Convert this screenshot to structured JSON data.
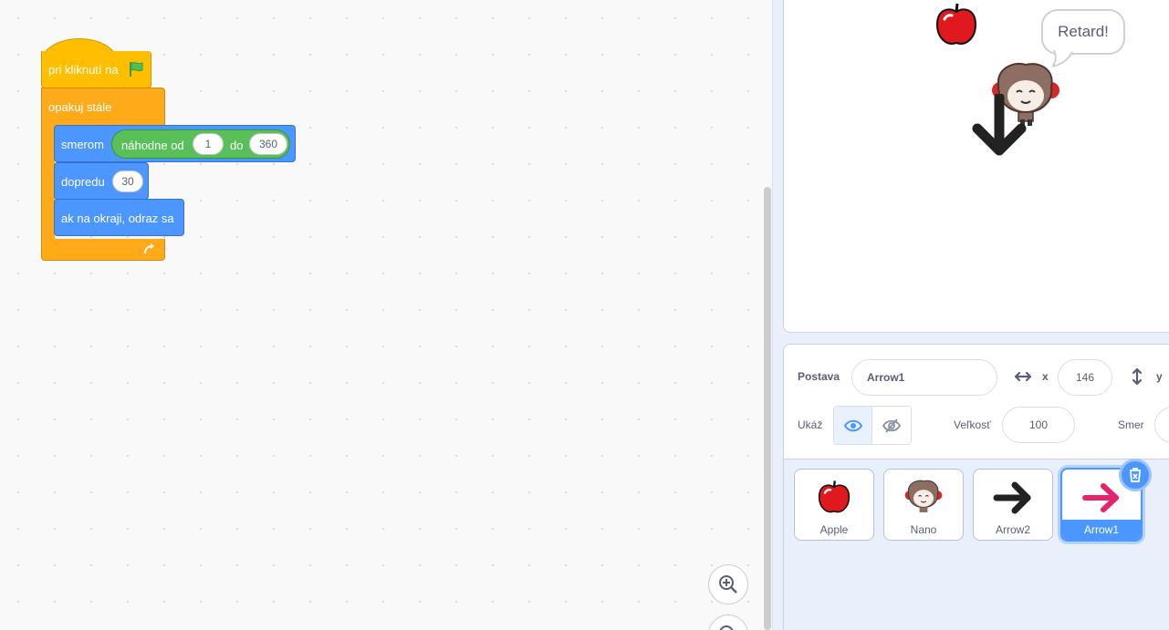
{
  "workspace": {
    "hat_label": "pri kliknutí na",
    "forever_label": "opakuj stále",
    "turn_label": "smerom",
    "random_label": "náhodne od",
    "random_from": "1",
    "random_to_label": "do",
    "random_to": "360",
    "move_label": "dopredu",
    "move_steps": "30",
    "bounce_label": "ak na okraji, odraz sa"
  },
  "stage": {
    "speech_text": "Retard!"
  },
  "sprite_info": {
    "sprite_label": "Postava",
    "sprite_name": "Arrow1",
    "x_label": "x",
    "x_value": "146",
    "y_label": "y",
    "show_label": "Ukáž",
    "size_label": "Veľkosť",
    "size_value": "100",
    "direction_label": "Smer"
  },
  "sprites": [
    {
      "name": "Apple",
      "icon": "apple-icon"
    },
    {
      "name": "Nano",
      "icon": "nano-icon"
    },
    {
      "name": "Arrow2",
      "icon": "arrow-right-black-icon"
    },
    {
      "name": "Arrow1",
      "icon": "arrow-right-pink-icon"
    }
  ],
  "selected_sprite": "Arrow1",
  "colors": {
    "events": "#ffbf00",
    "control": "#ffab19",
    "motion": "#4c97ff",
    "operators": "#59c059",
    "accent": "#4c97ff"
  }
}
